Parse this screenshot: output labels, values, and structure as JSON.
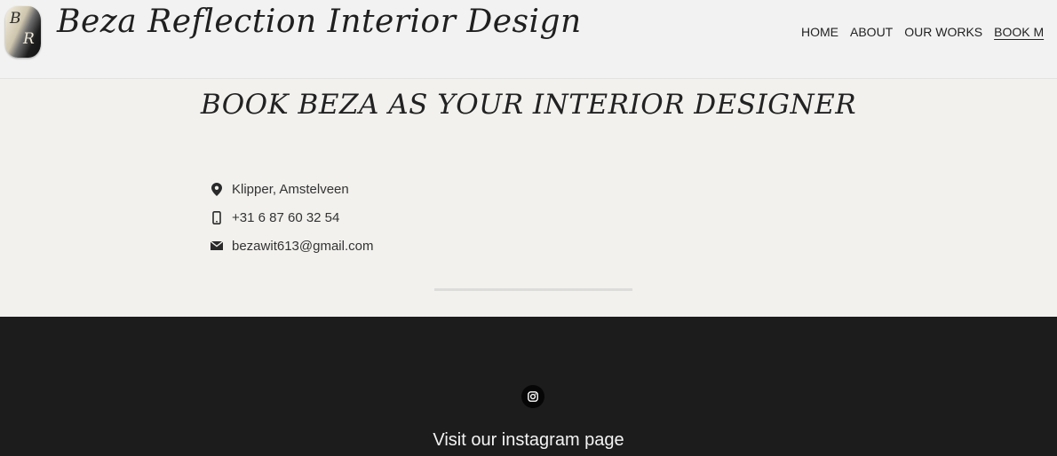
{
  "header": {
    "logo_letters": [
      "B",
      "R"
    ],
    "brand": "Beza Reflection Interior Design",
    "nav": [
      {
        "label": "HOME"
      },
      {
        "label": "ABOUT"
      },
      {
        "label": "OUR WORKS"
      },
      {
        "label": "BOOK M"
      }
    ],
    "active_nav": "BOOK M"
  },
  "main": {
    "heading": "BOOK BEZA AS YOUR INTERIOR DESIGNER",
    "contact": [
      {
        "icon": "location-pin-icon",
        "text": "Klipper, Amstelveen"
      },
      {
        "icon": "mobile-phone-icon",
        "text": "+31 6 87 60 32 54"
      },
      {
        "icon": "envelope-icon",
        "text": "bezawit613@gmail.com"
      }
    ]
  },
  "footer": {
    "icon": "instagram-icon",
    "text": "Visit our instagram page"
  },
  "colors": {
    "page_bg": "#f2f1ee",
    "header_bg": "#f2f2f2",
    "footer_bg": "#1c1c1c",
    "text": "#222222"
  }
}
